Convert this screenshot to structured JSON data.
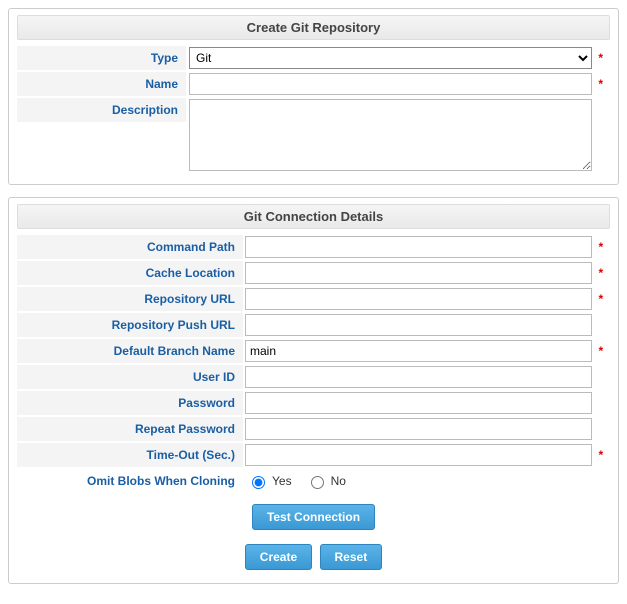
{
  "panel1": {
    "title": "Create Git Repository",
    "type_label": "Type",
    "type_value": "Git",
    "name_label": "Name",
    "name_value": "",
    "desc_label": "Description",
    "desc_value": ""
  },
  "panel2": {
    "title": "Git Connection Details",
    "command_path_label": "Command Path",
    "command_path_value": "",
    "cache_location_label": "Cache Location",
    "cache_location_value": "",
    "repo_url_label": "Repository URL",
    "repo_url_value": "",
    "repo_push_url_label": "Repository Push URL",
    "repo_push_url_value": "",
    "default_branch_label": "Default Branch Name",
    "default_branch_value": "main",
    "user_id_label": "User ID",
    "user_id_value": "",
    "password_label": "Password",
    "password_value": "",
    "repeat_password_label": "Repeat Password",
    "repeat_password_value": "",
    "timeout_label": "Time-Out (Sec.)",
    "timeout_value": "",
    "omit_blobs_label": "Omit Blobs When Cloning",
    "omit_yes": "Yes",
    "omit_no": "No",
    "test_btn": "Test Connection",
    "create_btn": "Create",
    "reset_btn": "Reset"
  },
  "required_marker": "*"
}
